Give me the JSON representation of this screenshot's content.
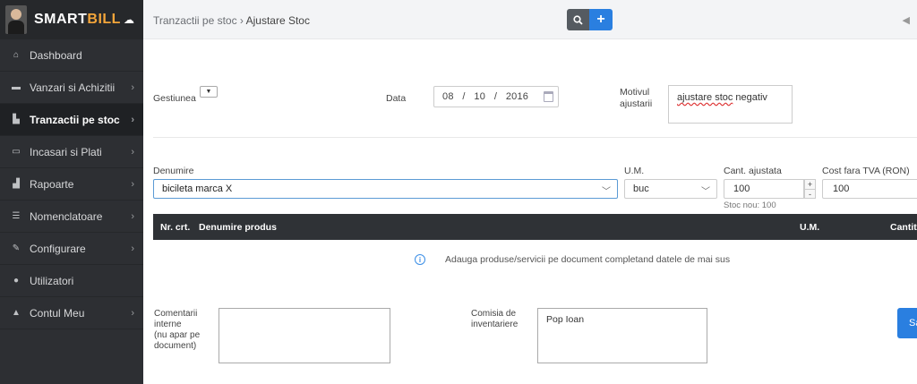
{
  "brand": {
    "smart": "SMART",
    "bill": "BILL"
  },
  "sidebar": {
    "items": [
      {
        "label": "Dashboard",
        "icon": "home-icon",
        "glyph": "⌂",
        "has_chevron": false,
        "active": false
      },
      {
        "label": "Vanzari si Achizitii",
        "icon": "cart-icon",
        "glyph": "▬",
        "has_chevron": true,
        "active": false
      },
      {
        "label": "Tranzactii pe stoc",
        "icon": "file-icon",
        "glyph": "▙",
        "has_chevron": true,
        "active": true
      },
      {
        "label": "Incasari si Plati",
        "icon": "money-icon",
        "glyph": "▭",
        "has_chevron": true,
        "active": false
      },
      {
        "label": "Rapoarte",
        "icon": "bar-chart-icon",
        "glyph": "▟",
        "has_chevron": true,
        "active": false
      },
      {
        "label": "Nomenclatoare",
        "icon": "list-icon",
        "glyph": "☰",
        "has_chevron": true,
        "active": false
      },
      {
        "label": "Configurare",
        "icon": "wrench-icon",
        "glyph": "✎",
        "has_chevron": true,
        "active": false
      },
      {
        "label": "Utilizatori",
        "icon": "users-icon",
        "glyph": "●",
        "has_chevron": false,
        "active": false
      },
      {
        "label": "Contul Meu",
        "icon": "user-icon",
        "glyph": "▲",
        "has_chevron": true,
        "active": false
      }
    ]
  },
  "topbar": {
    "breadcrumb_parent": "Tranzactii pe stoc",
    "breadcrumb_sep": " › ",
    "breadcrumb_current": "Ajustare Stoc",
    "add_label": "+"
  },
  "form": {
    "gestiunea_label": "Gestiunea",
    "data_label": "Data",
    "date_value": "08   /   10   /   2016",
    "motiv_label_1": "Motivul",
    "motiv_label_2": "ajustarii",
    "motiv_underlined": "ajustare stoc",
    "motiv_rest": " negativ",
    "denumire_label": "Denumire",
    "denumire_value": "bicileta marca X",
    "um_label": "U.M.",
    "um_value": "buc",
    "cant_label": "Cant. ajustata",
    "cant_value": "100",
    "stoc_nou": "Stoc nou: 100",
    "cost_label": "Cost fara TVA (RON)",
    "cost_value": "100",
    "stepper_up": "+",
    "stepper_down": "-"
  },
  "table": {
    "col_nr": "Nr. crt.",
    "col_denumire": "Denumire produs",
    "col_um": "U.M.",
    "col_cantitate": "Cantita"
  },
  "info": {
    "text": "Adauga produse/servicii pe document completand datele de mai sus"
  },
  "footer": {
    "comentarii_1": "Comentarii",
    "comentarii_2": "interne",
    "comentarii_3": "(nu apar pe",
    "comentarii_4": "document)",
    "comentarii_value": "",
    "comisia_1": "Comisia de",
    "comisia_2": "inventariere",
    "comisia_value": "Pop Ioan",
    "save_label": "Sa"
  },
  "colors": {
    "accent": "#2a7fe0",
    "sidebar": "#2d2f33",
    "brand_orange": "#f3a53a"
  }
}
